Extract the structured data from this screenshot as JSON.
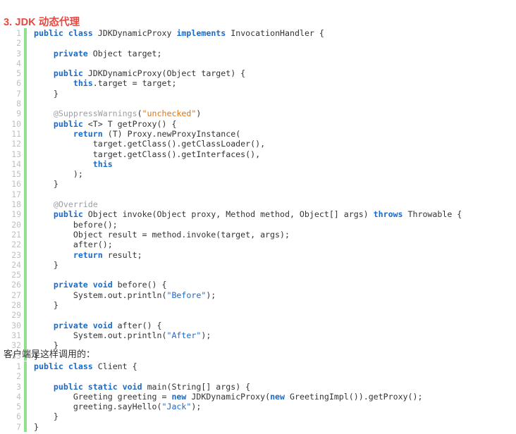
{
  "heading": {
    "text": "3. JDK 动态代理",
    "color": "#e8483f"
  },
  "prose": {
    "client_intro": "客户端是这样调用的："
  },
  "theme": {
    "keyword_color": "#1b6ac9",
    "string_color": "#1b6ac9",
    "string_alt_color": "#d9741a",
    "annotation_color": "#9aa0a6",
    "text_color": "#333333",
    "gutter_color": "#bfbfbf",
    "gutter_bar_color": "#8fe08f",
    "background": "#ffffff"
  },
  "code_blocks": [
    {
      "name": "jdk-dynamic-proxy",
      "language": "java",
      "line_count": 33,
      "lines": [
        {
          "n": 1,
          "tokens": [
            {
              "t": "public",
              "c": "key"
            },
            {
              "t": " ",
              "c": "plain"
            },
            {
              "t": "class",
              "c": "key"
            },
            {
              "t": " JDKDynamicProxy ",
              "c": "plain"
            },
            {
              "t": "implements",
              "c": "key"
            },
            {
              "t": " InvocationHandler {",
              "c": "plain"
            }
          ]
        },
        {
          "n": 2,
          "tokens": [
            {
              "t": "",
              "c": "plain"
            }
          ]
        },
        {
          "n": 3,
          "tokens": [
            {
              "t": "    ",
              "c": "plain"
            },
            {
              "t": "private",
              "c": "key"
            },
            {
              "t": " Object target;",
              "c": "plain"
            }
          ]
        },
        {
          "n": 4,
          "tokens": [
            {
              "t": "",
              "c": "plain"
            }
          ]
        },
        {
          "n": 5,
          "tokens": [
            {
              "t": "    ",
              "c": "plain"
            },
            {
              "t": "public",
              "c": "key"
            },
            {
              "t": " JDKDynamicProxy(Object target) {",
              "c": "plain"
            }
          ]
        },
        {
          "n": 6,
          "tokens": [
            {
              "t": "        ",
              "c": "plain"
            },
            {
              "t": "this",
              "c": "key"
            },
            {
              "t": ".target = target;",
              "c": "plain"
            }
          ]
        },
        {
          "n": 7,
          "tokens": [
            {
              "t": "    }",
              "c": "plain"
            }
          ]
        },
        {
          "n": 8,
          "tokens": [
            {
              "t": "",
              "c": "plain"
            }
          ]
        },
        {
          "n": 9,
          "tokens": [
            {
              "t": "    ",
              "c": "plain"
            },
            {
              "t": "@SuppressWarnings",
              "c": "anno"
            },
            {
              "t": "(",
              "c": "plain"
            },
            {
              "t": "\"unchecked\"",
              "c": "stro"
            },
            {
              "t": ")",
              "c": "plain"
            }
          ]
        },
        {
          "n": 10,
          "tokens": [
            {
              "t": "    ",
              "c": "plain"
            },
            {
              "t": "public",
              "c": "key"
            },
            {
              "t": " <T> T getProxy() {",
              "c": "plain"
            }
          ]
        },
        {
          "n": 11,
          "tokens": [
            {
              "t": "        ",
              "c": "plain"
            },
            {
              "t": "return",
              "c": "key"
            },
            {
              "t": " (T) Proxy.newProxyInstance(",
              "c": "plain"
            }
          ]
        },
        {
          "n": 12,
          "tokens": [
            {
              "t": "            target.getClass().getClassLoader(),",
              "c": "plain"
            }
          ]
        },
        {
          "n": 13,
          "tokens": [
            {
              "t": "            target.getClass().getInterfaces(),",
              "c": "plain"
            }
          ]
        },
        {
          "n": 14,
          "tokens": [
            {
              "t": "            ",
              "c": "plain"
            },
            {
              "t": "this",
              "c": "key"
            }
          ]
        },
        {
          "n": 15,
          "tokens": [
            {
              "t": "        );",
              "c": "plain"
            }
          ]
        },
        {
          "n": 16,
          "tokens": [
            {
              "t": "    }",
              "c": "plain"
            }
          ]
        },
        {
          "n": 17,
          "tokens": [
            {
              "t": "",
              "c": "plain"
            }
          ]
        },
        {
          "n": 18,
          "tokens": [
            {
              "t": "    ",
              "c": "plain"
            },
            {
              "t": "@Override",
              "c": "anno"
            }
          ]
        },
        {
          "n": 19,
          "tokens": [
            {
              "t": "    ",
              "c": "plain"
            },
            {
              "t": "public",
              "c": "key"
            },
            {
              "t": " Object invoke(Object proxy, Method method, Object[] args) ",
              "c": "plain"
            },
            {
              "t": "throws",
              "c": "key"
            },
            {
              "t": " Throwable {",
              "c": "plain"
            }
          ]
        },
        {
          "n": 20,
          "tokens": [
            {
              "t": "        before();",
              "c": "plain"
            }
          ]
        },
        {
          "n": 21,
          "tokens": [
            {
              "t": "        Object result = method.invoke(target, args);",
              "c": "plain"
            }
          ]
        },
        {
          "n": 22,
          "tokens": [
            {
              "t": "        after();",
              "c": "plain"
            }
          ]
        },
        {
          "n": 23,
          "tokens": [
            {
              "t": "        ",
              "c": "plain"
            },
            {
              "t": "return",
              "c": "key"
            },
            {
              "t": " result;",
              "c": "plain"
            }
          ]
        },
        {
          "n": 24,
          "tokens": [
            {
              "t": "    }",
              "c": "plain"
            }
          ]
        },
        {
          "n": 25,
          "tokens": [
            {
              "t": "",
              "c": "plain"
            }
          ]
        },
        {
          "n": 26,
          "tokens": [
            {
              "t": "    ",
              "c": "plain"
            },
            {
              "t": "private",
              "c": "key"
            },
            {
              "t": " ",
              "c": "plain"
            },
            {
              "t": "void",
              "c": "key"
            },
            {
              "t": " before() {",
              "c": "plain"
            }
          ]
        },
        {
          "n": 27,
          "tokens": [
            {
              "t": "        System.out.println(",
              "c": "plain"
            },
            {
              "t": "\"Before\"",
              "c": "str"
            },
            {
              "t": ");",
              "c": "plain"
            }
          ]
        },
        {
          "n": 28,
          "tokens": [
            {
              "t": "    }",
              "c": "plain"
            }
          ]
        },
        {
          "n": 29,
          "tokens": [
            {
              "t": "",
              "c": "plain"
            }
          ]
        },
        {
          "n": 30,
          "tokens": [
            {
              "t": "    ",
              "c": "plain"
            },
            {
              "t": "private",
              "c": "key"
            },
            {
              "t": " ",
              "c": "plain"
            },
            {
              "t": "void",
              "c": "key"
            },
            {
              "t": " after() {",
              "c": "plain"
            }
          ]
        },
        {
          "n": 31,
          "tokens": [
            {
              "t": "        System.out.println(",
              "c": "plain"
            },
            {
              "t": "\"After\"",
              "c": "str"
            },
            {
              "t": ");",
              "c": "plain"
            }
          ]
        },
        {
          "n": 32,
          "tokens": [
            {
              "t": "    }",
              "c": "plain"
            }
          ]
        },
        {
          "n": 33,
          "tokens": [
            {
              "t": "}",
              "c": "plain"
            }
          ]
        }
      ]
    },
    {
      "name": "client-usage",
      "language": "java",
      "line_count": 7,
      "lines": [
        {
          "n": 1,
          "tokens": [
            {
              "t": "public",
              "c": "key"
            },
            {
              "t": " ",
              "c": "plain"
            },
            {
              "t": "class",
              "c": "key"
            },
            {
              "t": " Client {",
              "c": "plain"
            }
          ]
        },
        {
          "n": 2,
          "tokens": [
            {
              "t": "",
              "c": "plain"
            }
          ]
        },
        {
          "n": 3,
          "tokens": [
            {
              "t": "    ",
              "c": "plain"
            },
            {
              "t": "public",
              "c": "key"
            },
            {
              "t": " ",
              "c": "plain"
            },
            {
              "t": "static",
              "c": "key"
            },
            {
              "t": " ",
              "c": "plain"
            },
            {
              "t": "void",
              "c": "key"
            },
            {
              "t": " main(String[] args) {",
              "c": "plain"
            }
          ]
        },
        {
          "n": 4,
          "tokens": [
            {
              "t": "        Greeting greeting = ",
              "c": "plain"
            },
            {
              "t": "new",
              "c": "key"
            },
            {
              "t": " JDKDynamicProxy(",
              "c": "plain"
            },
            {
              "t": "new",
              "c": "key"
            },
            {
              "t": " GreetingImpl()).getProxy();",
              "c": "plain"
            }
          ]
        },
        {
          "n": 5,
          "tokens": [
            {
              "t": "        greeting.sayHello(",
              "c": "plain"
            },
            {
              "t": "\"Jack\"",
              "c": "str"
            },
            {
              "t": ");",
              "c": "plain"
            }
          ]
        },
        {
          "n": 6,
          "tokens": [
            {
              "t": "    }",
              "c": "plain"
            }
          ]
        },
        {
          "n": 7,
          "tokens": [
            {
              "t": "}",
              "c": "plain"
            }
          ]
        }
      ]
    }
  ]
}
